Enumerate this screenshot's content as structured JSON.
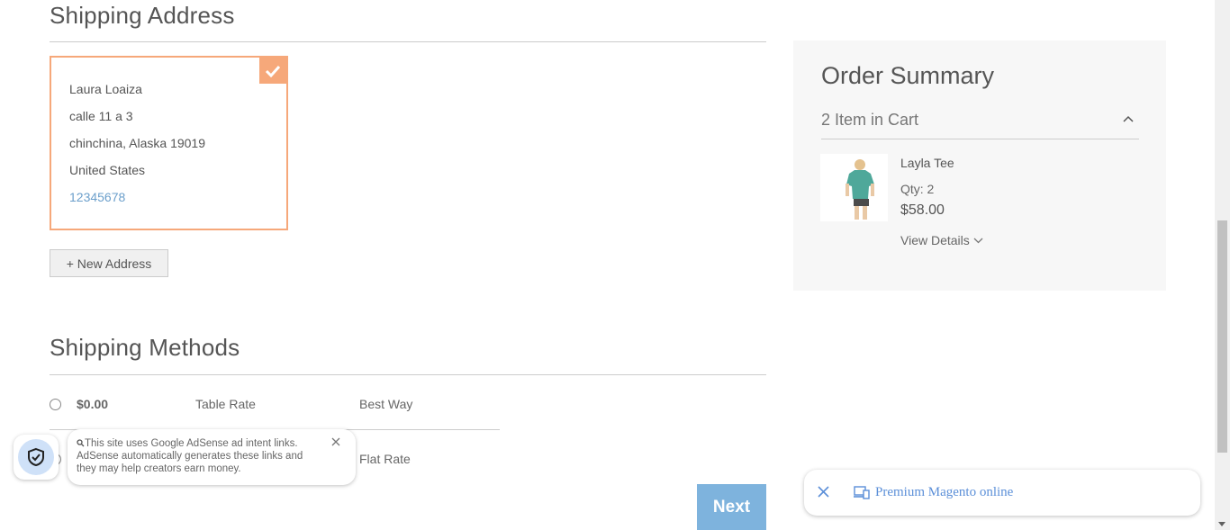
{
  "shipping_address": {
    "title": "Shipping Address",
    "selected": {
      "name": "Laura Loaiza",
      "street": "calle 11 a 3",
      "city_region_zip": "chinchina, Alaska 19019",
      "country": "United States",
      "phone": "12345678"
    },
    "new_address_label": "+ New Address"
  },
  "shipping_methods": {
    "title": "Shipping Methods",
    "rows": [
      {
        "price": "$0.00",
        "carrier": "Table Rate",
        "method": "Best Way"
      },
      {
        "price": "",
        "carrier": "",
        "method": "Flat Rate"
      }
    ],
    "next_label": "Next"
  },
  "order_summary": {
    "title": "Order Summary",
    "items_count": "2 Item in Cart",
    "product": {
      "name": "Layla Tee",
      "qty": "Qty: 2",
      "price": "$58.00",
      "view_details": "View Details"
    }
  },
  "adsense_notice": {
    "text": "This site uses Google AdSense ad intent links. AdSense automatically generates these links and they may help creators earn money."
  },
  "premium_bar": {
    "text": "Premium Magento online"
  },
  "colors": {
    "accent_orange": "#f6a87a",
    "next_button": "#7eb3dd",
    "link_blue": "#6b9fcb"
  }
}
